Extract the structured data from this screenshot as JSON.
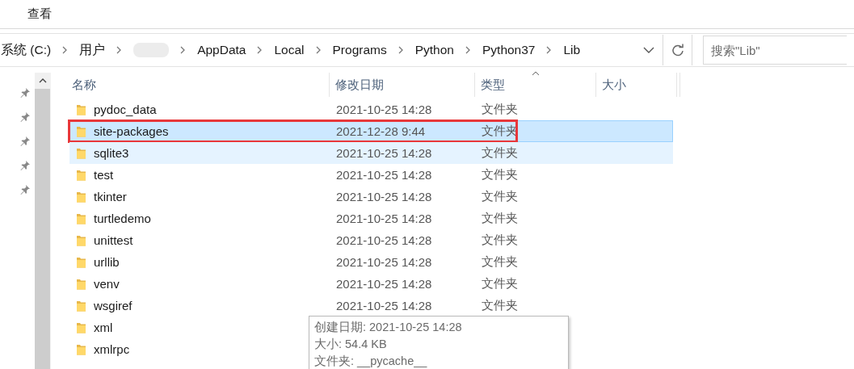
{
  "ribbon": {
    "tabs": [
      {
        "label": "查看",
        "selected": false
      }
    ]
  },
  "address_bar": {
    "crumbs": [
      {
        "label": "系统 (C:)"
      },
      {
        "label": "用户"
      },
      {
        "kind": "redacted"
      },
      {
        "label": "AppData"
      },
      {
        "label": "Local"
      },
      {
        "label": "Programs"
      },
      {
        "label": "Python"
      },
      {
        "label": "Python37"
      },
      {
        "label": "Lib"
      }
    ]
  },
  "search": {
    "placeholder": "搜索\"Lib\""
  },
  "quick_access": {
    "items": [
      {
        "pinned": true
      },
      {
        "pinned": true
      },
      {
        "pinned": true
      },
      {
        "pinned": true
      },
      {
        "pinned": true
      }
    ]
  },
  "table": {
    "columns": [
      {
        "label": "名称",
        "sorted": false
      },
      {
        "label": "修改日期",
        "sorted": false
      },
      {
        "label": "类型",
        "sorted": true
      },
      {
        "label": "大小",
        "sorted": false
      }
    ],
    "rows": [
      {
        "kind": "folder",
        "name": "pydoc_data",
        "date": "2021-10-25 14:28",
        "type": "文件夹",
        "selected": false,
        "hovered": false,
        "annotated": false
      },
      {
        "kind": "folder",
        "name": "site-packages",
        "date": "2021-12-28 9:44",
        "type": "文件夹",
        "selected": true,
        "hovered": false,
        "annotated": true
      },
      {
        "kind": "folder",
        "name": "sqlite3",
        "date": "2021-10-25 14:28",
        "type": "文件夹",
        "selected": false,
        "hovered": true,
        "annotated": false
      },
      {
        "kind": "folder",
        "name": "test",
        "date": "2021-10-25 14:28",
        "type": "文件夹",
        "selected": false,
        "hovered": false,
        "annotated": false
      },
      {
        "kind": "folder",
        "name": "tkinter",
        "date": "2021-10-25 14:28",
        "type": "文件夹",
        "selected": false,
        "hovered": false,
        "annotated": false
      },
      {
        "kind": "folder",
        "name": "turtledemo",
        "date": "2021-10-25 14:28",
        "type": "文件夹",
        "selected": false,
        "hovered": false,
        "annotated": false
      },
      {
        "kind": "folder",
        "name": "unittest",
        "date": "2021-10-25 14:28",
        "type": "文件夹",
        "selected": false,
        "hovered": false,
        "annotated": false
      },
      {
        "kind": "folder",
        "name": "urllib",
        "date": "2021-10-25 14:28",
        "type": "文件夹",
        "selected": false,
        "hovered": false,
        "annotated": false
      },
      {
        "kind": "folder",
        "name": "venv",
        "date": "2021-10-25 14:28",
        "type": "文件夹",
        "selected": false,
        "hovered": false,
        "annotated": false
      },
      {
        "kind": "folder",
        "name": "wsgiref",
        "date": "2021-10-25 14:28",
        "type": "文件夹",
        "selected": false,
        "hovered": false,
        "annotated": false
      },
      {
        "kind": "folder",
        "name": "xml",
        "selected": false,
        "hovered": false,
        "annotated": false
      },
      {
        "kind": "folder",
        "name": "xmlrpc",
        "selected": false,
        "hovered": false,
        "annotated": false
      }
    ]
  },
  "tooltip": {
    "lines": [
      "创建日期: 2021-10-25 14:28",
      "大小: 54.4 KB",
      "文件夹: __pycache__"
    ]
  }
}
